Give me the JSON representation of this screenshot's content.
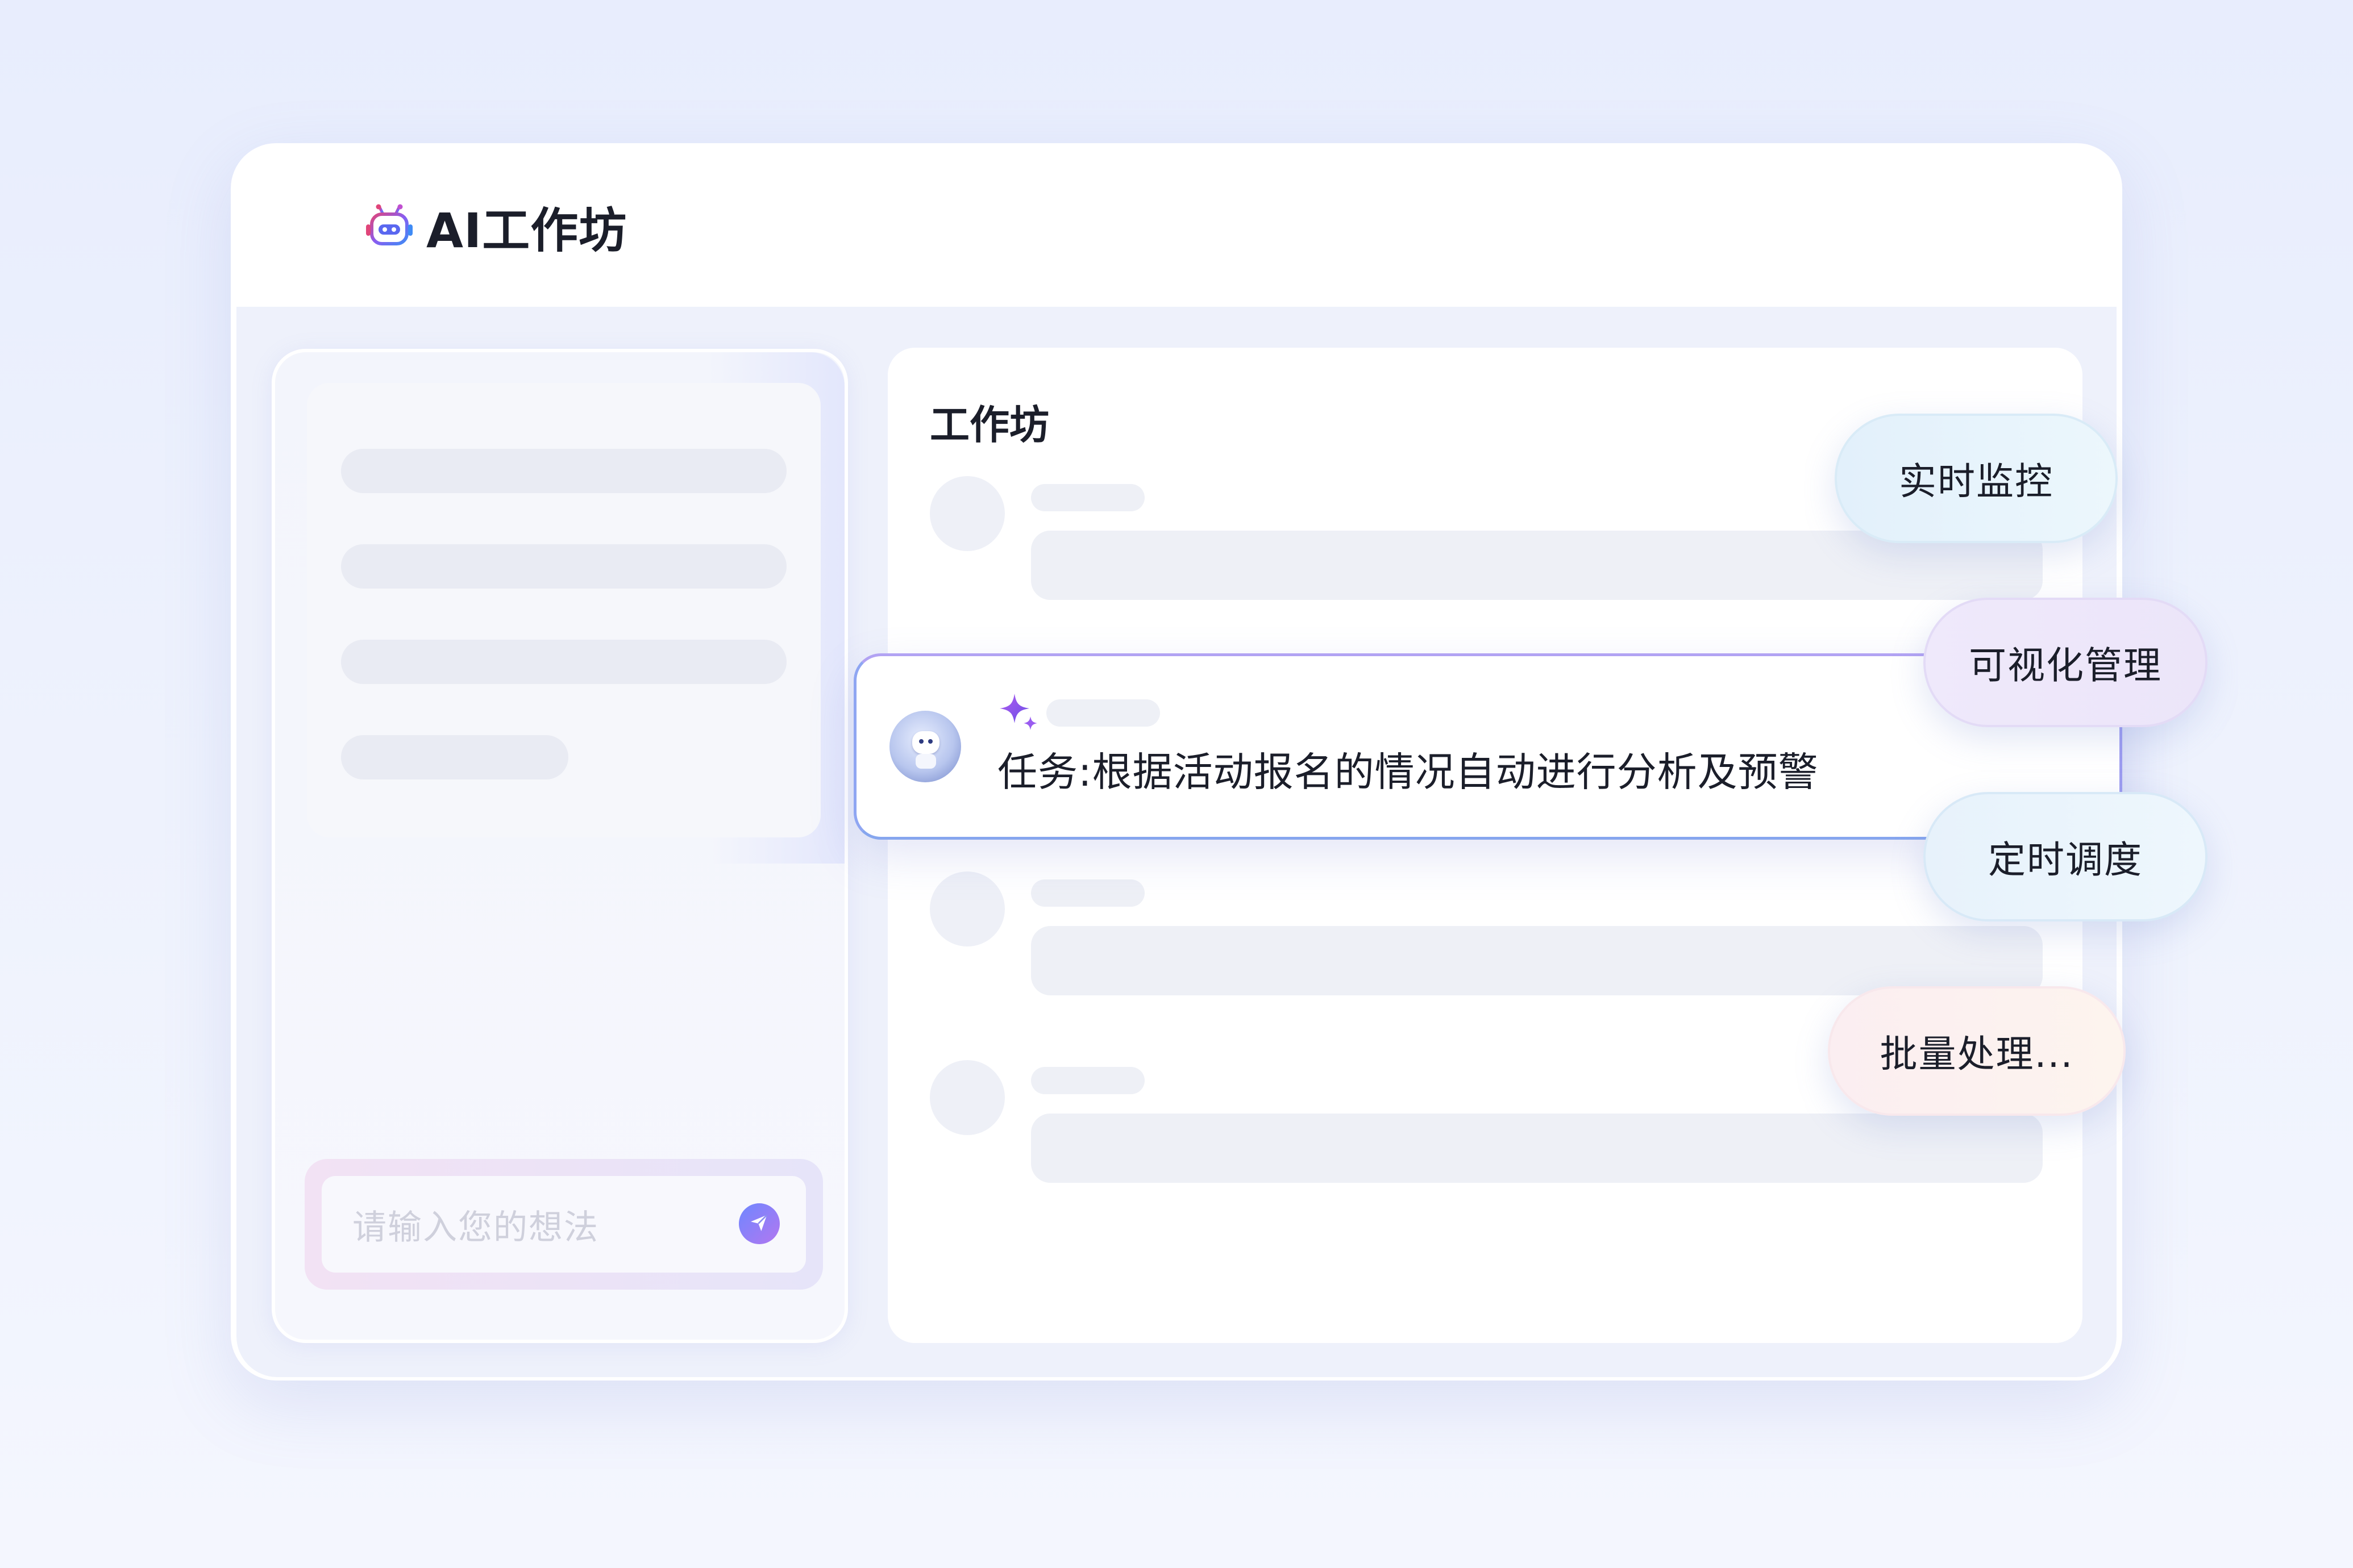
{
  "app": {
    "title": "AI工作坊",
    "logo_icon": "robot-icon"
  },
  "chat": {
    "input_placeholder": "请输入您的想法",
    "send_icon": "send-icon"
  },
  "workshop": {
    "title": "工作坊",
    "task": {
      "text": "任务:根据活动报名的情况自动进行分析及预警",
      "icon": "sparkle-icon"
    }
  },
  "features": [
    {
      "label": "实时监控"
    },
    {
      "label": "可视化管理"
    },
    {
      "label": "定时调度"
    },
    {
      "label": "批量处理..."
    }
  ],
  "colors": {
    "accent_blue": "#6f87ff",
    "accent_purple": "#a65ff0",
    "background": "#e8edfd"
  }
}
